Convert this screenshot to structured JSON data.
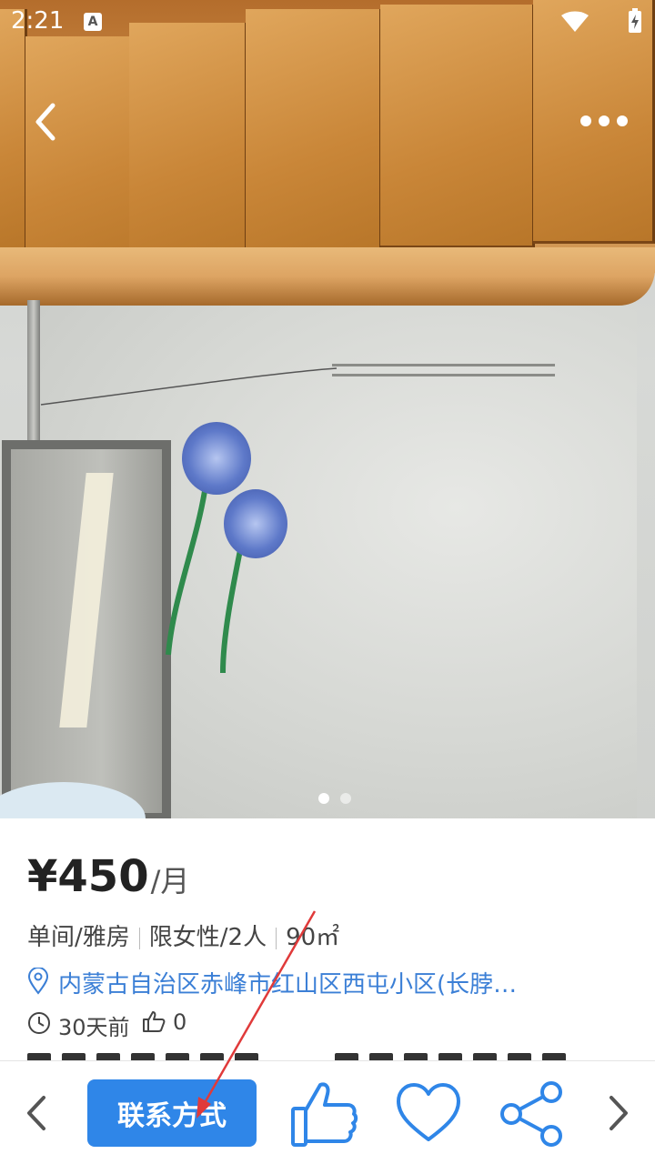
{
  "status_bar": {
    "time": "2:21",
    "notification_letter": "A",
    "icons": [
      "wifi-icon",
      "battery-charging-icon"
    ]
  },
  "top_nav": {
    "back_icon": "chevron-left-icon",
    "more_icon": "more-horizontal-icon"
  },
  "gallery": {
    "image_count": 2,
    "current_index": 1
  },
  "listing": {
    "price": "¥450",
    "price_unit": "/月",
    "specs": [
      "单间/雅房",
      "限女性/2人",
      "90㎡"
    ],
    "address": "内蒙古自治区赤峰市红山区西屯小区(长脖…",
    "posted_ago": "30天前",
    "likes": "0"
  },
  "bottom_bar": {
    "prev_icon": "chevron-left-icon",
    "contact_label": "联系方式",
    "like_icon": "thumbs-up-icon",
    "favorite_icon": "heart-icon",
    "share_icon": "share-icon",
    "next_icon": "chevron-right-icon"
  },
  "colors": {
    "accent": "#2f86e8",
    "address_link": "#3b7fd6",
    "annotation_arrow": "#e03a3a"
  }
}
